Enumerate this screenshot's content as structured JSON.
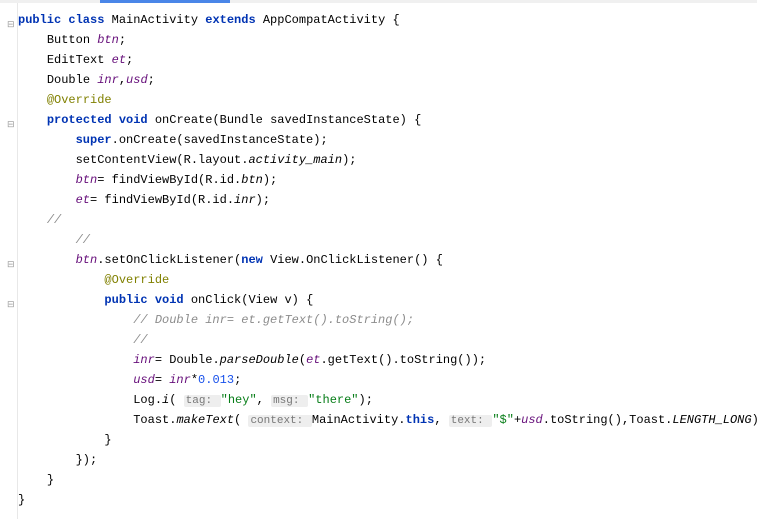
{
  "tabs": {
    "active_indicator": true
  },
  "code": {
    "lines": [
      {
        "i": 0,
        "segs": [
          [
            "kw",
            "public class "
          ],
          [
            "type",
            "MainActivity "
          ],
          [
            "kw",
            "extends "
          ],
          [
            "type",
            "AppCompatActivity "
          ],
          [
            "",
            "{"
          ]
        ]
      },
      {
        "i": 1,
        "segs": [
          [
            "",
            "Button "
          ],
          [
            "field",
            "btn"
          ],
          [
            "",
            ";"
          ]
        ]
      },
      {
        "i": 1,
        "segs": [
          [
            "",
            "EditText "
          ],
          [
            "field",
            "et"
          ],
          [
            "",
            ";"
          ]
        ]
      },
      {
        "i": 1,
        "segs": [
          [
            "",
            "Double "
          ],
          [
            "field",
            "inr"
          ],
          [
            "",
            ","
          ],
          [
            "field",
            "usd"
          ],
          [
            "",
            ";"
          ]
        ]
      },
      {
        "i": 1,
        "segs": [
          [
            "anno",
            "@Override"
          ]
        ]
      },
      {
        "i": 1,
        "segs": [
          [
            "kw",
            "protected void "
          ],
          [
            "method",
            "onCreate"
          ],
          [
            "",
            "(Bundle savedInstanceState) {"
          ]
        ]
      },
      {
        "i": 2,
        "segs": [
          [
            "kw",
            "super"
          ],
          [
            "",
            ".onCreate(savedInstanceState);"
          ]
        ]
      },
      {
        "i": 2,
        "segs": [
          [
            "",
            "setContentView(R.layout."
          ],
          [
            "static",
            "activity_main"
          ],
          [
            "",
            ");"
          ]
        ]
      },
      {
        "i": 2,
        "segs": [
          [
            "field",
            "btn"
          ],
          [
            "",
            "= findViewById(R.id."
          ],
          [
            "static",
            "btn"
          ],
          [
            "",
            ");"
          ]
        ]
      },
      {
        "i": 2,
        "segs": [
          [
            "field",
            "et"
          ],
          [
            "",
            "= findViewById(R.id."
          ],
          [
            "static",
            "inr"
          ],
          [
            "",
            ");"
          ]
        ]
      },
      {
        "i": 1,
        "segs": [
          [
            "comment",
            "//"
          ]
        ]
      },
      {
        "i": 2,
        "segs": [
          [
            "comment",
            "//"
          ]
        ]
      },
      {
        "i": 2,
        "segs": [
          [
            "field",
            "btn"
          ],
          [
            "",
            ".setOnClickListener("
          ],
          [
            "kw",
            "new "
          ],
          [
            "",
            "View.OnClickListener() {"
          ]
        ]
      },
      {
        "i": 3,
        "segs": [
          [
            "anno",
            "@Override"
          ]
        ]
      },
      {
        "i": 3,
        "segs": [
          [
            "kw",
            "public void "
          ],
          [
            "method",
            "onClick"
          ],
          [
            "",
            "(View v) {"
          ]
        ]
      },
      {
        "i": 4,
        "segs": [
          [
            "comment",
            "// Double inr= et.getText().toString();"
          ]
        ]
      },
      {
        "i": 4,
        "segs": [
          [
            "comment",
            "//"
          ]
        ]
      },
      {
        "i": 4,
        "segs": [
          [
            "field",
            "inr"
          ],
          [
            "",
            "= Double."
          ],
          [
            "static",
            "parseDouble"
          ],
          [
            "",
            "("
          ],
          [
            "field",
            "et"
          ],
          [
            "",
            ".getText().toString());"
          ]
        ]
      },
      {
        "i": 4,
        "segs": [
          [
            "field",
            "usd"
          ],
          [
            "",
            "= "
          ],
          [
            "field",
            "inr"
          ],
          [
            "",
            "*"
          ],
          [
            "num",
            "0.013"
          ],
          [
            "",
            ";"
          ]
        ]
      },
      {
        "i": 4,
        "segs": [
          [
            "",
            "Log."
          ],
          [
            "static",
            "i"
          ],
          [
            "",
            "( "
          ],
          [
            "hint",
            "tag: "
          ],
          [
            "str",
            "\"hey\""
          ],
          [
            "",
            ", "
          ],
          [
            "hint",
            "msg: "
          ],
          [
            "str",
            "\"there\""
          ],
          [
            "",
            ");"
          ]
        ]
      },
      {
        "i": 4,
        "segs": [
          [
            "",
            "Toast."
          ],
          [
            "static",
            "makeText"
          ],
          [
            "",
            "( "
          ],
          [
            "hint",
            "context: "
          ],
          [
            "",
            "MainActivity."
          ],
          [
            "kw",
            "this"
          ],
          [
            "",
            ", "
          ],
          [
            "hint",
            "text: "
          ],
          [
            "str",
            "\"$\""
          ],
          [
            "",
            "+"
          ],
          [
            "field",
            "usd"
          ],
          [
            "",
            ".toString(),Toast."
          ],
          [
            "static",
            "LENGTH_LONG"
          ],
          [
            "",
            ").show();"
          ]
        ]
      },
      {
        "i": 3,
        "segs": [
          [
            "",
            "}"
          ]
        ]
      },
      {
        "i": 2,
        "segs": [
          [
            "",
            "});"
          ]
        ]
      },
      {
        "i": 1,
        "segs": [
          [
            "",
            "}"
          ]
        ]
      },
      {
        "i": 0,
        "segs": [
          [
            "",
            "}"
          ]
        ]
      }
    ]
  },
  "folds": [
    26,
    126,
    266,
    306
  ]
}
